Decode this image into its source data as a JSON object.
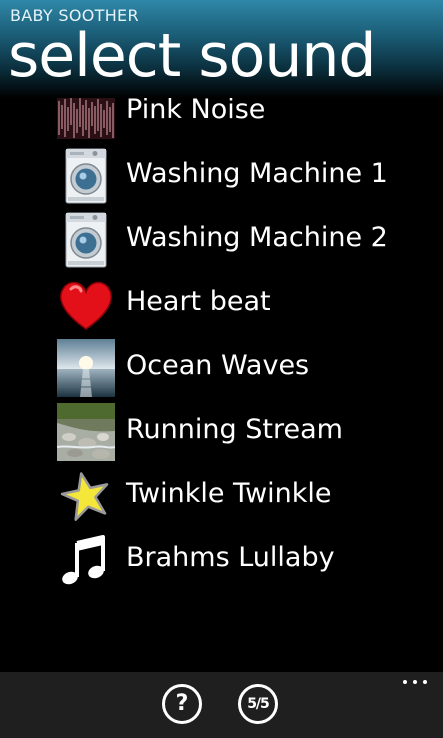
{
  "header": {
    "app_title": "BABY SOOTHER",
    "page_title": "select sound"
  },
  "sounds": [
    {
      "label": "Pink Noise",
      "icon": "pink-noise-icon"
    },
    {
      "label": "Washing Machine 1",
      "icon": "washing-machine-icon"
    },
    {
      "label": "Washing Machine 2",
      "icon": "washing-machine-icon"
    },
    {
      "label": "Heart beat",
      "icon": "heart-icon"
    },
    {
      "label": "Ocean Waves",
      "icon": "ocean-icon"
    },
    {
      "label": "Running Stream",
      "icon": "stream-icon"
    },
    {
      "label": "Twinkle Twinkle",
      "icon": "star-icon"
    },
    {
      "label": "Brahms Lullaby",
      "icon": "music-note-icon"
    }
  ],
  "appbar": {
    "help_label": "?",
    "count_label": "5/5",
    "more_icon": "more-dots-icon"
  },
  "colors": {
    "header_accent": "#2f87a8",
    "background": "#000000",
    "appbar": "#1f1f1f",
    "heart": "#e3101a",
    "star": "#f5e63a"
  }
}
